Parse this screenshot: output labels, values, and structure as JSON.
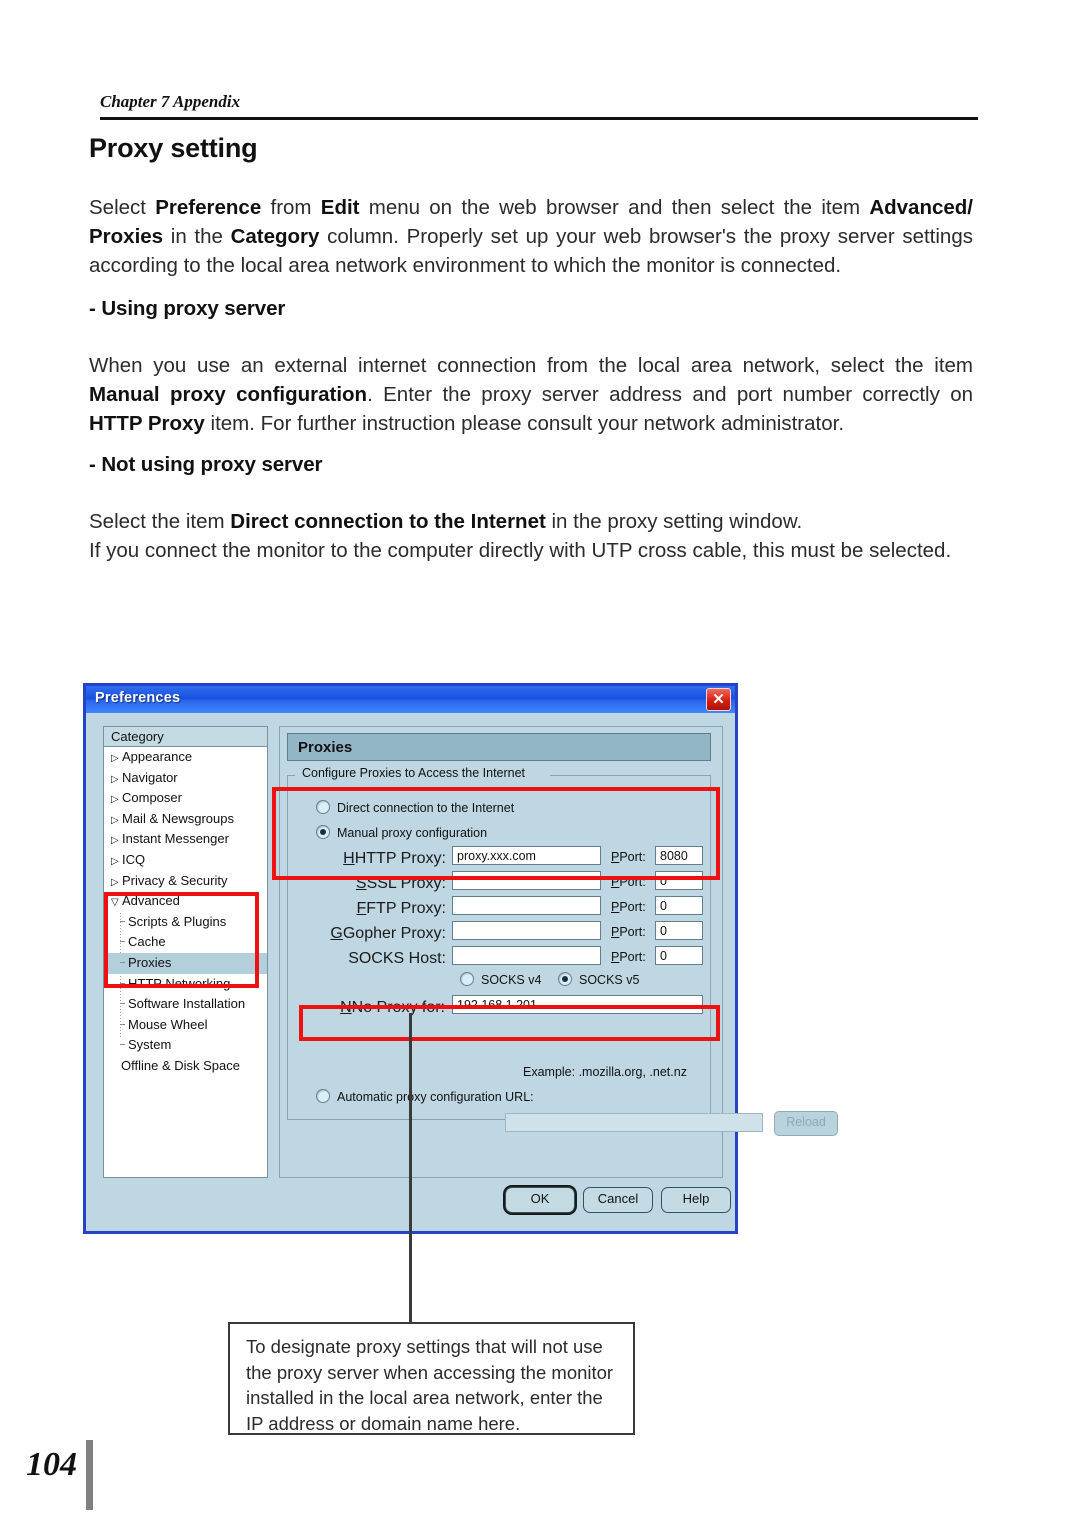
{
  "page": {
    "chapter": "Chapter 7 Appendix",
    "number": "104",
    "title": "Proxy setting"
  },
  "intro": {
    "s1": "Select ",
    "b1": "Preference",
    "s2": " from ",
    "b2": "Edit",
    "s3": " menu on the web browser and then select the item ",
    "b3": "Advanced/ Proxies",
    "s4": " in the ",
    "b4": "Category",
    "s5": " column. Properly set up your web browser's the proxy server settings according to the local area network environment to which the monitor is connected."
  },
  "using": {
    "heading": "- Using proxy server",
    "s1": "When you use an external internet connection from the local area network, select the item ",
    "b1": "Manual proxy configuration",
    "s2": ". Enter the proxy server address and port number correctly on ",
    "b2": "HTTP Proxy",
    "s3": " item. For further instruction please consult your network administrator."
  },
  "notusing": {
    "heading": "- Not using proxy server",
    "s1": "Select the item ",
    "b1": "Direct connection to the Internet",
    "s2": " in the proxy setting window.",
    "s3": "If you connect the monitor to the computer directly with UTP cross cable, this must be selected."
  },
  "dialog": {
    "title": "Preferences",
    "close_label": "✕",
    "category": {
      "header": "Category",
      "items": [
        {
          "label": "Appearance",
          "level": 0,
          "marker": "collapsed"
        },
        {
          "label": "Navigator",
          "level": 0,
          "marker": "collapsed"
        },
        {
          "label": "Composer",
          "level": 0,
          "marker": "collapsed"
        },
        {
          "label": "Mail & Newsgroups",
          "level": 0,
          "marker": "collapsed"
        },
        {
          "label": "Instant Messenger",
          "level": 0,
          "marker": "collapsed"
        },
        {
          "label": "ICQ",
          "level": 0,
          "marker": "collapsed"
        },
        {
          "label": "Privacy & Security",
          "level": 0,
          "marker": "collapsed"
        },
        {
          "label": "Advanced",
          "level": 0,
          "marker": "expanded"
        },
        {
          "label": "Scripts & Plugins",
          "level": 1,
          "marker": "leaf"
        },
        {
          "label": "Cache",
          "level": 1,
          "marker": "leaf"
        },
        {
          "label": "Proxies",
          "level": 1,
          "marker": "leaf",
          "selected": true
        },
        {
          "label": "HTTP Networking",
          "level": 1,
          "marker": "leaf"
        },
        {
          "label": "Software Installation",
          "level": 1,
          "marker": "leaf"
        },
        {
          "label": "Mouse Wheel",
          "level": 1,
          "marker": "leaf"
        },
        {
          "label": "System",
          "level": 1,
          "marker": "leaf"
        },
        {
          "label": "Offline & Disk Space",
          "level": 2,
          "marker": "none"
        }
      ]
    },
    "pane": {
      "title": "Proxies",
      "group_legend": "Configure Proxies to Access the Internet",
      "radio_direct": "Direct connection to the Internet",
      "radio_manual": "Manual proxy configuration",
      "fields": [
        {
          "label": "HTTP Proxy:",
          "value": "proxy.xxx.com",
          "port_label": "Port:",
          "port": "8080"
        },
        {
          "label": "SSL Proxy:",
          "value": "",
          "port_label": "Port:",
          "port": "0"
        },
        {
          "label": "FTP Proxy:",
          "value": "",
          "port_label": "Port:",
          "port": "0"
        },
        {
          "label": "Gopher Proxy:",
          "value": "",
          "port_label": "Port:",
          "port": "0"
        },
        {
          "label": "SOCKS Host:",
          "value": "",
          "port_label": "Port:",
          "port": "0"
        }
      ],
      "socks_v4": "SOCKS v4",
      "socks_v5": "SOCKS v5",
      "noproxy_label": "No Proxy for:",
      "noproxy_value": "192.168.1.201",
      "example": "Example: .mozilla.org, .net.nz",
      "radio_auto": "Automatic proxy configuration URL:",
      "autoproxy_value": "",
      "reload_label": "Reload"
    },
    "buttons": {
      "ok": "OK",
      "cancel": "Cancel",
      "help": "Help"
    }
  },
  "callout": {
    "text": "To designate proxy settings that will not use the proxy server when accessing the monitor installed in the local area network, enter the IP address or domain name here."
  },
  "colors": {
    "highlight": "#ee1111",
    "titlebar": "#1a4fe0",
    "dialog_bg": "#bfd7e2",
    "pane_header": "#93b6c6",
    "selection": "#b3cfdb"
  }
}
